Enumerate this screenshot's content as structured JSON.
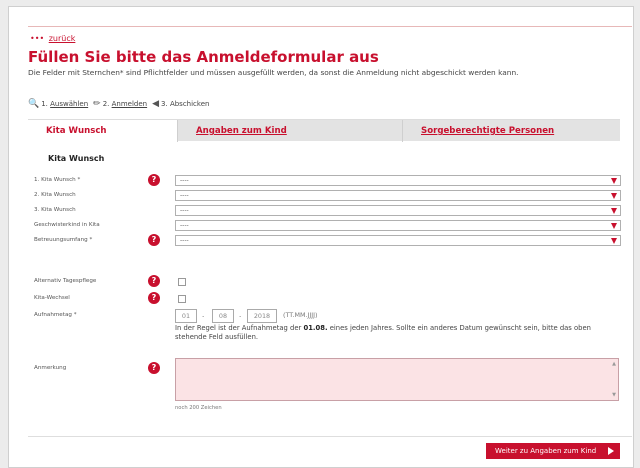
{
  "nav": {
    "back_dots": "•••",
    "back_label": "zurück"
  },
  "header": {
    "title": "Füllen Sie bitte das Anmeldeformular aus",
    "subtitle": "Die Felder mit Sternchen* sind Pflichtfelder und müssen ausgefüllt werden, da sonst die Anmeldung nicht abgeschickt werden kann."
  },
  "steps": [
    {
      "number": "1.",
      "label": "Auswählen",
      "icon": "search-icon"
    },
    {
      "number": "2.",
      "label": "Anmelden",
      "icon": "pencil-icon"
    },
    {
      "number": "3.",
      "label": "Abschicken",
      "icon": "send-icon"
    }
  ],
  "tabs": [
    {
      "label": "Kita Wunsch",
      "active": true
    },
    {
      "label": "Angaben zum Kind",
      "active": false
    },
    {
      "label": "Sorgeberechtigte Personen",
      "active": false
    }
  ],
  "section_title": "Kita Wunsch",
  "fields": {
    "kita1": {
      "label": "1. Kita Wunsch *",
      "value": "----"
    },
    "kita2": {
      "label": "2. Kita Wunsch",
      "value": "----"
    },
    "kita3": {
      "label": "3. Kita Wunsch",
      "value": "----"
    },
    "geschwister": {
      "label": "Geschwisterkind in Kita",
      "value": "----"
    },
    "betreuung": {
      "label": "Betreuungsumfang *",
      "value": "----"
    },
    "tagespflege": {
      "label": "Alternativ Tagespflege"
    },
    "kitawechsel": {
      "label": "Kita-Wechsel"
    },
    "aufnahmetag": {
      "label": "Aufnahmetag *",
      "day": "01",
      "month": "08",
      "year": "2018",
      "separator": ".",
      "format_hint": "(TT.MM.JJJJ)"
    },
    "anmerkung": {
      "label": "Anmerkung",
      "counter": "noch 200 Zeichen"
    }
  },
  "info": {
    "before": "In der Regel ist der Aufnahmetag der ",
    "bold": "01.08.",
    "after": " eines jeden Jahres. Sollte ein anderes Datum gewünscht sein, bitte das oben stehende Feld ausfüllen."
  },
  "help_glyph": "?",
  "next_button": "Weiter zu Angaben zum Kind",
  "colors": {
    "accent": "#c8102e",
    "textarea_bg": "#fbe3e5",
    "tab_bg": "#e3e3e3"
  }
}
